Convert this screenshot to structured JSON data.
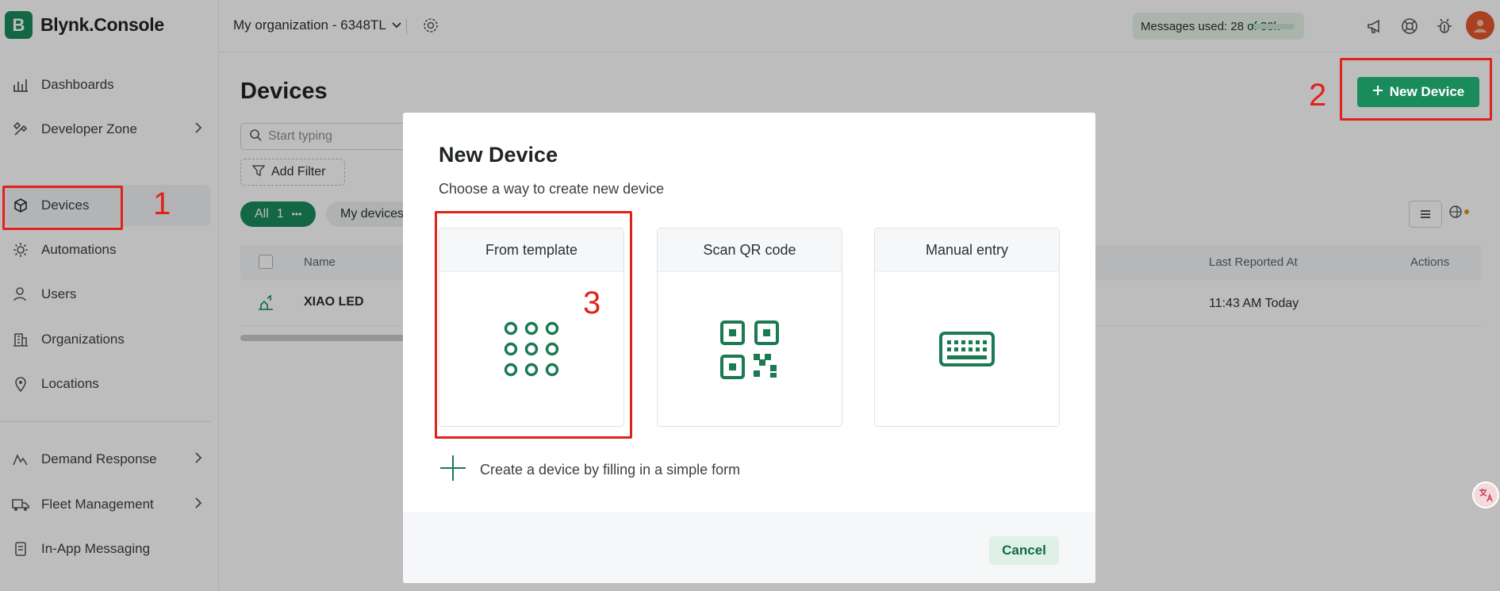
{
  "brand": {
    "logo_letter": "B",
    "name": "Blynk.Console"
  },
  "sidebar": {
    "items": [
      {
        "label": "Dashboards",
        "icon": "bar-chart-icon"
      },
      {
        "label": "Developer Zone",
        "icon": "tools-icon",
        "has_chevron": true
      },
      {
        "label": "Devices",
        "icon": "cube-icon",
        "active": true
      },
      {
        "label": "Automations",
        "icon": "sun-gear-icon"
      },
      {
        "label": "Users",
        "icon": "user-icon"
      },
      {
        "label": "Organizations",
        "icon": "building-icon"
      },
      {
        "label": "Locations",
        "icon": "map-pin-icon"
      },
      {
        "label": "Demand Response",
        "icon": "pulse-icon",
        "has_chevron": true
      },
      {
        "label": "Fleet Management",
        "icon": "truck-icon",
        "has_chevron": true
      },
      {
        "label": "In-App Messaging",
        "icon": "message-icon"
      }
    ]
  },
  "topbar": {
    "org_name": "My organization - 6348TL",
    "messages_used": "Messages used: 28 of 30k",
    "messages_fraction": 0.0009
  },
  "main": {
    "title": "Devices",
    "search_placeholder": "Start typing",
    "add_filter_label": "Add Filter",
    "chip_all_label": "All",
    "chip_all_count": "1",
    "chip_all_more": "•••",
    "chip_my_devices": "My devices",
    "new_device_label": "New Device",
    "table": {
      "columns": {
        "name": "Name",
        "last_reported": "Last Reported At",
        "actions": "Actions"
      },
      "rows": [
        {
          "name": "XIAO LED",
          "last_reported": "11:43 AM Today"
        }
      ]
    }
  },
  "modal": {
    "title": "New Device",
    "subtitle": "Choose a way to create new device",
    "cards": [
      {
        "label": "From template",
        "icon": "grid-dots-icon"
      },
      {
        "label": "Scan QR code",
        "icon": "qr-code-icon"
      },
      {
        "label": "Manual entry",
        "icon": "keyboard-icon"
      }
    ],
    "simple_form_label": "Create a device by filling in a simple form",
    "cancel_label": "Cancel"
  },
  "annotations": {
    "n1": "1",
    "n2": "2",
    "n3": "3"
  },
  "colors": {
    "brand_green": "#1a8c5c",
    "annotation_red": "#e0221b"
  }
}
